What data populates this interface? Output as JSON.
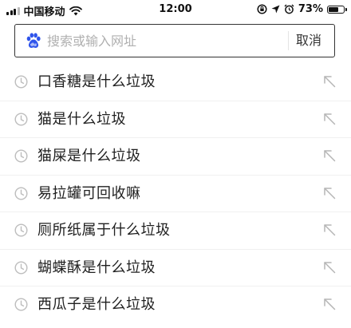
{
  "status_bar": {
    "carrier": "中国移动",
    "time": "12:00",
    "battery_percent": "73%",
    "battery_level": 0.73,
    "icons": [
      "signal-icon",
      "wifi-icon",
      "orientation-lock-icon",
      "location-icon",
      "alarm-icon",
      "battery-icon"
    ]
  },
  "search": {
    "icon": "baidu-paw-icon",
    "placeholder": "搜索或输入网址",
    "cancel_label": "取消"
  },
  "history": [
    {
      "label": "口香糖是什么垃圾",
      "icon": "clock-icon",
      "action_icon": "fill-arrow-icon"
    },
    {
      "label": "猫是什么垃圾",
      "icon": "clock-icon",
      "action_icon": "fill-arrow-icon"
    },
    {
      "label": "猫屎是什么垃圾",
      "icon": "clock-icon",
      "action_icon": "fill-arrow-icon"
    },
    {
      "label": "易拉罐可回收嘛",
      "icon": "clock-icon",
      "action_icon": "fill-arrow-icon"
    },
    {
      "label": "厕所纸属于什么垃圾",
      "icon": "clock-icon",
      "action_icon": "fill-arrow-icon"
    },
    {
      "label": "蝴蝶酥是什么垃圾",
      "icon": "clock-icon",
      "action_icon": "fill-arrow-icon"
    },
    {
      "label": "西瓜子是什么垃圾",
      "icon": "clock-icon",
      "action_icon": "fill-arrow-icon"
    }
  ],
  "colors": {
    "brand": "#2f54eb",
    "text": "#1f1f1f",
    "icon_gray": "#b5b5b5",
    "placeholder": "#b0b0b0"
  }
}
